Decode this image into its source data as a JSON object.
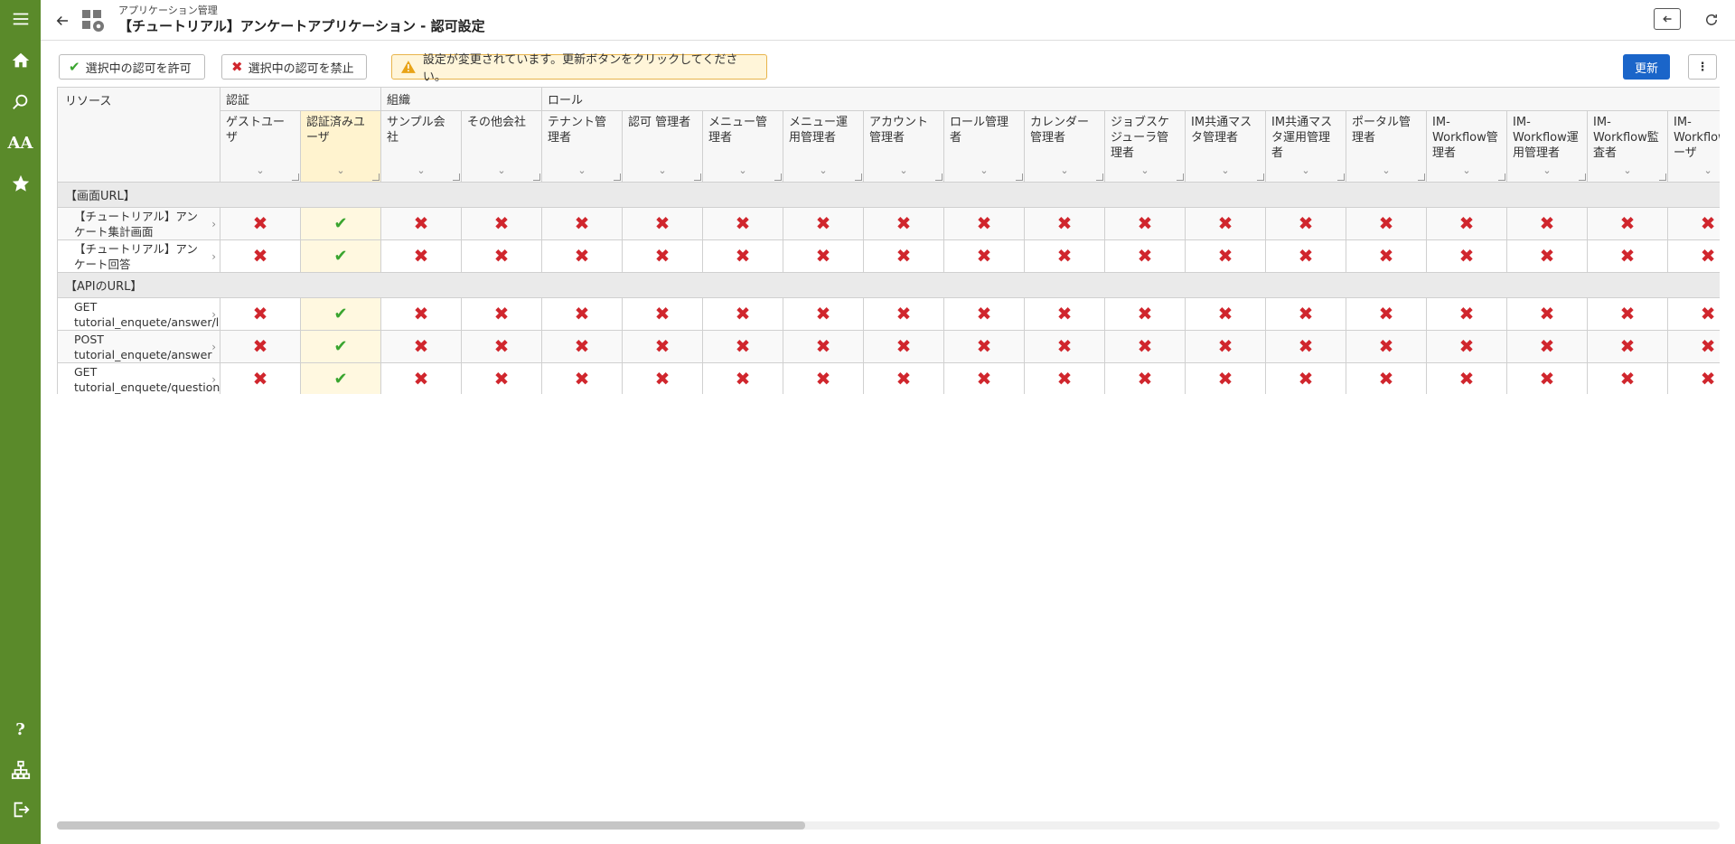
{
  "header": {
    "breadcrumb": "アプリケーション管理",
    "title": "【チュートリアル】アンケートアプリケーション - 認可設定"
  },
  "sidebar": {
    "items": [
      {
        "icon": "menu-icon"
      },
      {
        "icon": "home-icon"
      },
      {
        "icon": "search-icon"
      },
      {
        "icon": "font-size-icon",
        "label": "AA"
      },
      {
        "icon": "star-icon"
      },
      {
        "icon": "help-icon",
        "label": "?"
      },
      {
        "icon": "sitemap-icon"
      },
      {
        "icon": "logout-icon"
      }
    ]
  },
  "toolbar": {
    "allow_label": "選択中の認可を許可",
    "deny_label": "選択中の認可を禁止",
    "warning": "設定が変更されています。更新ボタンをクリックしてください。",
    "update_label": "更新",
    "more_label": "⋮"
  },
  "grid": {
    "resource_header": "リソース",
    "groups": [
      {
        "label": "認証",
        "span": 2
      },
      {
        "label": "組織",
        "span": 2
      },
      {
        "label": "ロール",
        "span": 15
      }
    ],
    "columns": [
      "ゲストユーザ",
      "認証済みユーザ",
      "サンプル会社",
      "その他会社",
      "テナント管理者",
      "認可 管理者",
      "メニュー管理者",
      "メニュー運用管理者",
      "アカウント管理者",
      "ロール管理者",
      "カレンダー管理者",
      "ジョブスケジューラ管理者",
      "IM共通マスタ管理者",
      "IM共通マスタ運用管理者",
      "ポータル管理者",
      "IM-Workflow管理者",
      "IM-Workflow運用管理者",
      "IM-Workflow監査者",
      "IM-Workflowユーザ"
    ],
    "selected_column": 1,
    "sections": [
      {
        "label": "【画面URL】",
        "rows": [
          {
            "name": "【チュートリアル】アンケート集計画面",
            "allowed": [
              1
            ]
          },
          {
            "name": "【チュートリアル】アンケート回答",
            "allowed": [
              1
            ]
          }
        ]
      },
      {
        "label": "【APIのURL】",
        "rows": [
          {
            "name": "GET tutorial_enquete/answer/list",
            "allowed": [
              1
            ]
          },
          {
            "name": "POST tutorial_enquete/answer",
            "allowed": [
              1
            ]
          },
          {
            "name": "GET tutorial_enquete/question",
            "allowed": [
              1
            ]
          }
        ]
      }
    ]
  },
  "scroll": {
    "horizontal_fraction": 0.45
  }
}
